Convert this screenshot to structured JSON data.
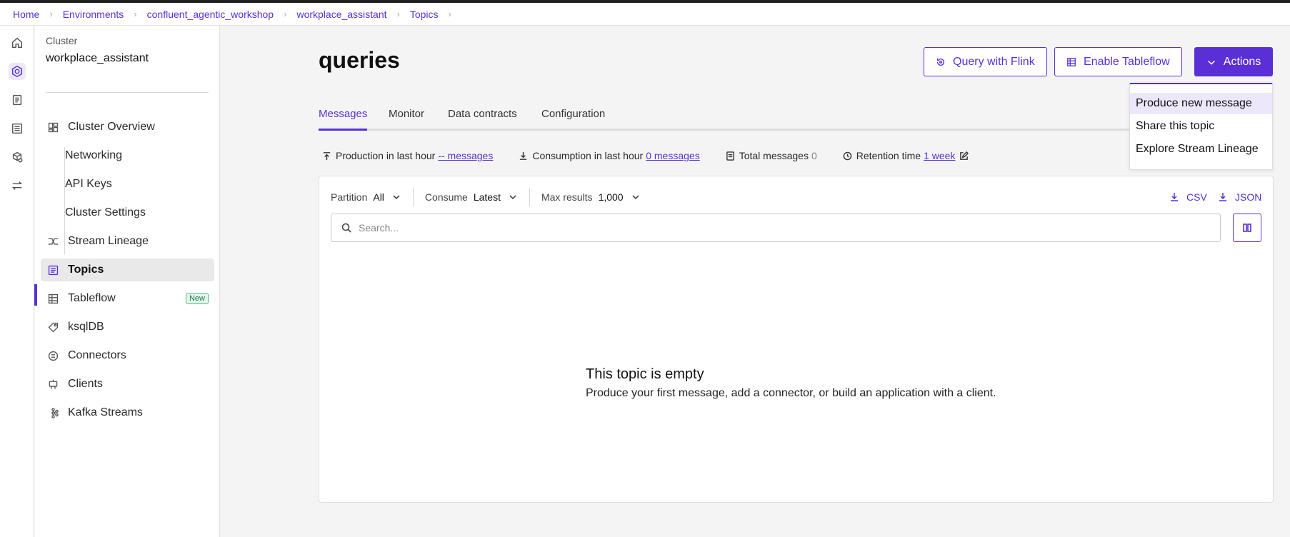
{
  "breadcrumb": [
    "Home",
    "Environments",
    "confluent_agentic_workshop",
    "workplace_assistant",
    "Topics"
  ],
  "rail": [
    "home-icon",
    "cluster-icon",
    "document-icon",
    "list-icon",
    "schema-icon",
    "swap-icon"
  ],
  "sidebar": {
    "cluster_label": "Cluster",
    "cluster_name": "workplace_assistant",
    "items": [
      {
        "label": "Cluster Overview",
        "icon": "dashboard-icon"
      },
      {
        "label": "Networking"
      },
      {
        "label": "API Keys"
      },
      {
        "label": "Cluster Settings"
      },
      {
        "label": "Stream Lineage",
        "icon": "lineage-icon"
      },
      {
        "label": "Topics",
        "icon": "topics-icon",
        "active": true
      },
      {
        "label": "Tableflow",
        "icon": "tableflow-icon",
        "badge": "New"
      },
      {
        "label": "ksqlDB",
        "icon": "ksqldb-icon"
      },
      {
        "label": "Connectors",
        "icon": "connectors-icon"
      },
      {
        "label": "Clients",
        "icon": "clients-icon"
      },
      {
        "label": "Kafka Streams",
        "icon": "kafka-streams-icon"
      }
    ]
  },
  "header": {
    "title": "queries",
    "query_flink": "Query with Flink",
    "enable_tableflow": "Enable Tableflow",
    "actions": "Actions"
  },
  "tabs": [
    "Messages",
    "Monitor",
    "Data contracts",
    "Configuration"
  ],
  "stats": {
    "production_label": "Production in last hour",
    "production_value": "-- messages",
    "consumption_label": "Consumption in last hour",
    "consumption_value": "0 messages",
    "total_label": "Total messages",
    "total_value": "0",
    "retention_label": "Retention time",
    "retention_value": "1 week"
  },
  "filters": {
    "partition_label": "Partition",
    "partition_value": "All",
    "consume_label": "Consume",
    "consume_value": "Latest",
    "max_label": "Max results",
    "max_value": "1,000"
  },
  "downloads": {
    "csv": "CSV",
    "json": "JSON"
  },
  "search": {
    "placeholder": "Search..."
  },
  "empty": {
    "title": "This topic is empty",
    "description": "Produce your first message, add a connector, or build an application with a client."
  },
  "actions_menu": [
    "Produce new message",
    "Share this topic",
    "Explore Stream Lineage"
  ],
  "colors": {
    "accent": "#5a2fd6"
  }
}
